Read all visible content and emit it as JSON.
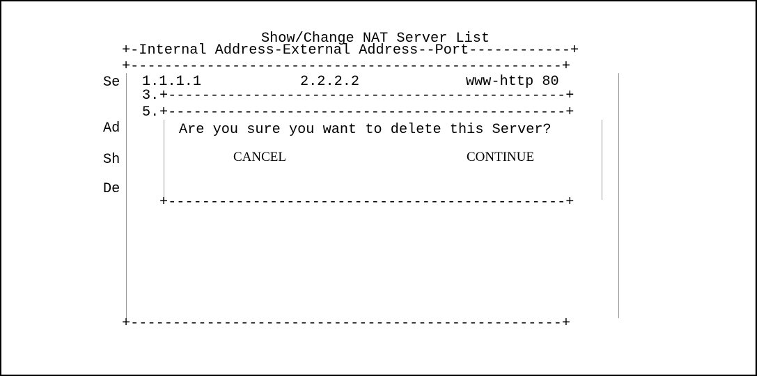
{
  "screen": {
    "title": "Show/Change NAT Server List",
    "table_header": "+-Internal Address-External Address--Port------------+",
    "list_top_border": "+---------------------------------------------------+",
    "list_bottom_border": "+---------------------------------------------------+",
    "server_entry": {
      "internal_address": "1.1.1.1",
      "external_address": "2.2.2.2",
      "port": "www-http 80"
    },
    "row_3_marker": "3.",
    "row_5_marker": "5.",
    "row_3_border": "+-----------------------------------------------+",
    "row_5_border": "+-----------------------------------------------+",
    "side_menu": [
      {
        "label": "Se"
      },
      {
        "label": "Ad"
      },
      {
        "label": "Sh"
      },
      {
        "label": "De"
      }
    ]
  },
  "dialog": {
    "message": "Are you sure you want to delete this Server?",
    "cancel_label": "CANCEL",
    "continue_label": "CONTINUE",
    "bottom_border": "+-----------------------------------------------+"
  }
}
